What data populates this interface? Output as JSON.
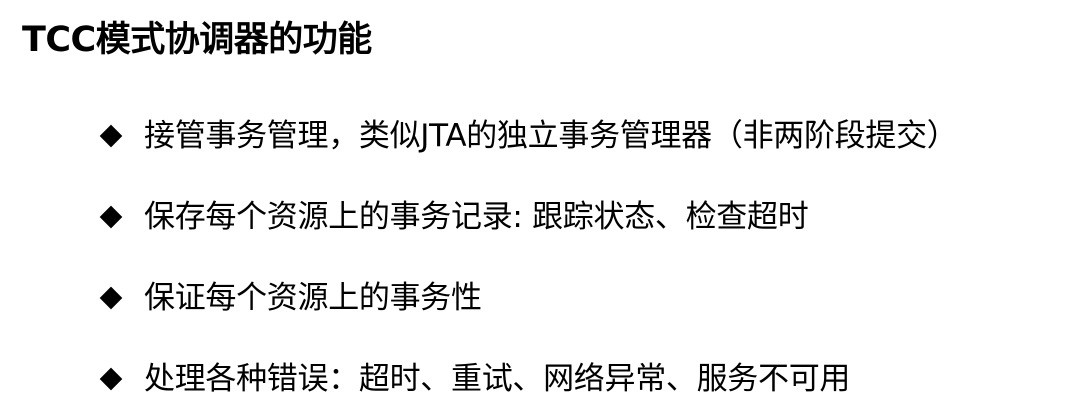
{
  "title": "TCC模式协调器的功能",
  "bullets": [
    {
      "icon": "diamond-bullet-icon",
      "text": "接管事务管理，类似JTA的独立事务管理器（非两阶段提交）"
    },
    {
      "icon": "diamond-bullet-icon",
      "text": "保存每个资源上的事务记录: 跟踪状态、检查超时"
    },
    {
      "icon": "diamond-bullet-icon",
      "text": "保证每个资源上的事务性"
    },
    {
      "icon": "diamond-bullet-icon",
      "text": "处理各种错误：超时、重试、网络异常、服务不可用"
    }
  ],
  "colors": {
    "background": "#ffffff",
    "text": "#000000",
    "bullet": "#000000"
  }
}
